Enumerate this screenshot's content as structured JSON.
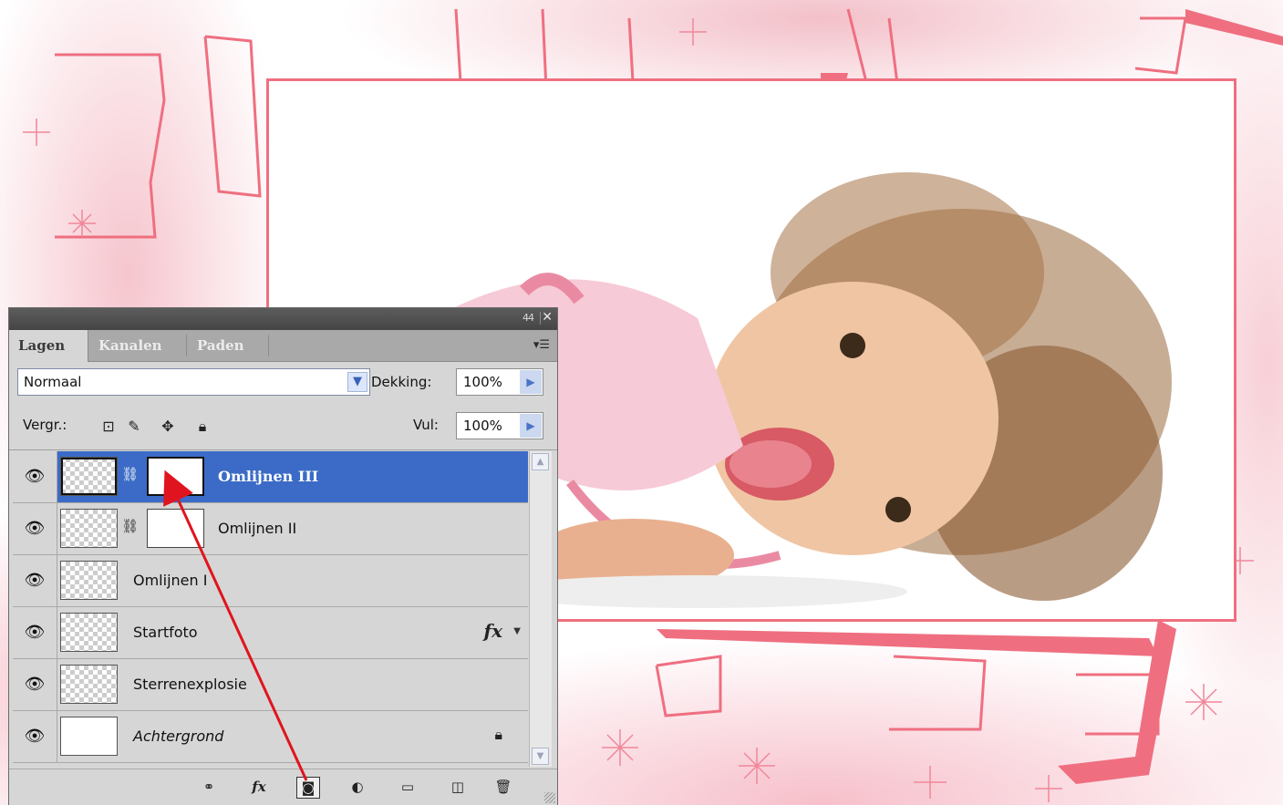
{
  "panel": {
    "window_controls": {
      "collapse": "44",
      "close": "✕"
    },
    "tabs": [
      {
        "label": "Lagen",
        "active": true
      },
      {
        "label": "Kanalen",
        "active": false
      },
      {
        "label": "Paden",
        "active": false
      }
    ],
    "menu_icon": "panel-menu-icon",
    "blend_mode": "Normaal",
    "opacity_label": "Dekking:",
    "opacity_value": "100%",
    "lock_label": "Vergr.:",
    "fill_label": "Vul:",
    "fill_value": "100%",
    "layers": [
      {
        "name": "Omlijnen III",
        "selected": true,
        "has_mask": true
      },
      {
        "name": "Omlijnen II",
        "selected": false,
        "has_mask": true
      },
      {
        "name": "Omlijnen I",
        "selected": false,
        "has_mask": false
      },
      {
        "name": "Startfoto",
        "selected": false,
        "effects": "fx"
      },
      {
        "name": "Sterrenexplosie",
        "selected": false
      },
      {
        "name": "Achtergrond",
        "selected": false,
        "locked": true
      }
    ]
  },
  "colors": {
    "frame": "#ef6f80",
    "selection": "#3b6bc6",
    "annotation_arrow": "#e0141e"
  }
}
